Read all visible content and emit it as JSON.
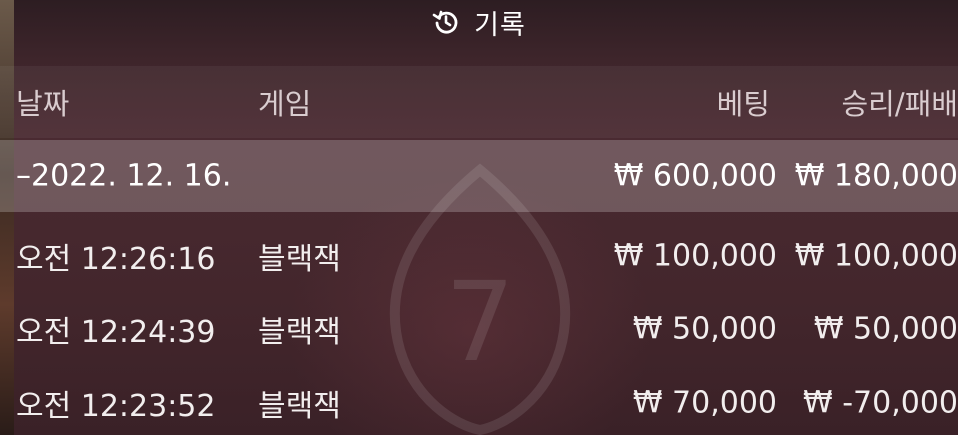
{
  "header": {
    "title": "기록",
    "icon": "history-icon"
  },
  "columns": {
    "date": "날짜",
    "game": "게임",
    "bet": "베팅",
    "result": "승리/패배"
  },
  "group": {
    "date": "–2022. 12. 16.",
    "bet": "₩ 600,000",
    "result": "₩ 180,000"
  },
  "rows": [
    {
      "time": "오전 12:26:16",
      "game": "블랙잭",
      "bet": "₩ 100,000",
      "result": "₩ 100,000"
    },
    {
      "time": "오전 12:24:39",
      "game": "블랙잭",
      "bet": "₩ 50,000",
      "result": "₩ 50,000"
    },
    {
      "time": "오전 12:23:52",
      "game": "블랙잭",
      "bet": "₩ 70,000",
      "result": "₩ -70,000"
    }
  ]
}
